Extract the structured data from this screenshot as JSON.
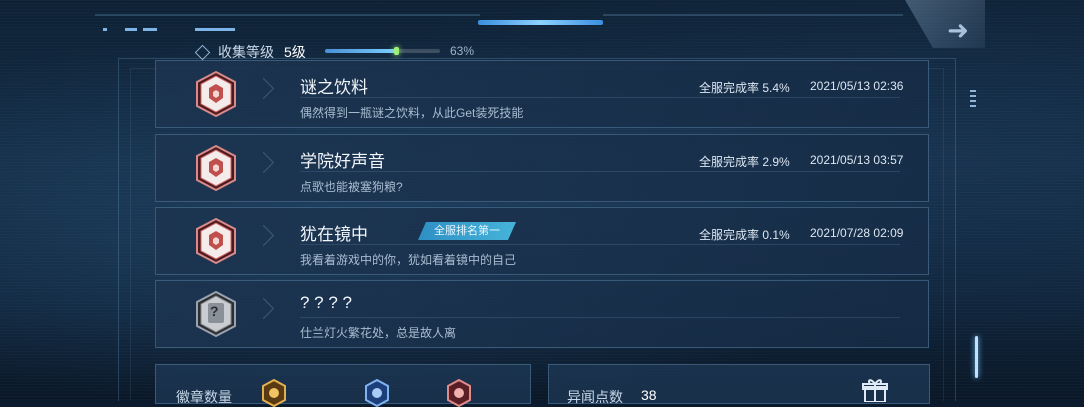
{
  "collection": {
    "level_label": "收集等级",
    "level_value": "5级",
    "progress_percent": 63,
    "progress_text": "63%"
  },
  "achievements": [
    {
      "title": "谜之饮料",
      "description": "偶然得到一瓶谜之饮料，从此Get装死技能",
      "completion": "全服完成率 5.4%",
      "date": "2021/05/13 02:36",
      "badge_icon": "red-emblem-icon",
      "tag": ""
    },
    {
      "title": "学院好声音",
      "description": "点歌也能被塞狗粮?",
      "completion": "全服完成率 2.9%",
      "date": "2021/05/13 03:57",
      "badge_icon": "red-emblem-icon",
      "tag": ""
    },
    {
      "title": "犹在镜中",
      "description": "我看着游戏中的你，犹如看着镜中的自己",
      "completion": "全服完成率 0.1%",
      "date": "2021/07/28 02:09",
      "badge_icon": "red-emblem-icon",
      "tag": "全服排名第一"
    },
    {
      "title": "? ? ? ?",
      "description": "仕兰灯火繁花处，总是故人离",
      "completion": "",
      "date": "",
      "badge_icon": "locked-question-icon",
      "tag": ""
    }
  ],
  "footer": {
    "badge_count_label": "徽章数量",
    "points_label": "异闻点数",
    "points_value": "38"
  },
  "colors": {
    "accent": "#46b4d9",
    "progress": "#7ad0ff",
    "badge_red": "#c0504d",
    "badge_gold": "#d9a441"
  }
}
